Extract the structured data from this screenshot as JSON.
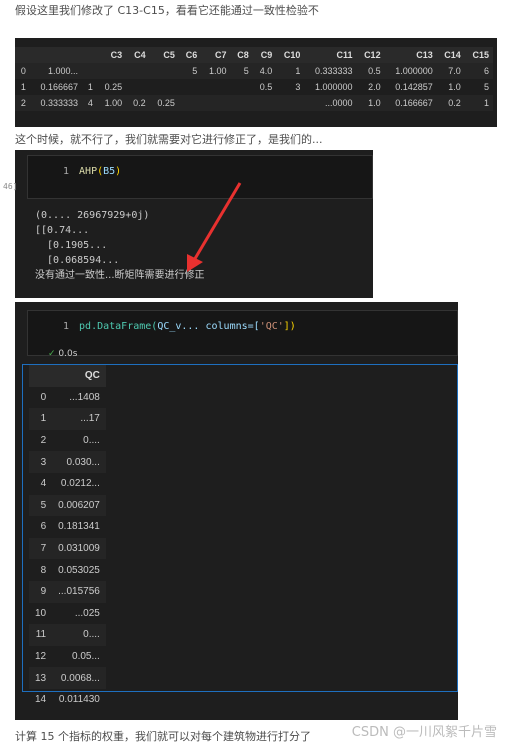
{
  "text1": "假设这里我们修改了 C13-C15，看看它还能通过一致性检验不",
  "table1": {
    "headers": [
      "",
      "",
      "",
      "C3",
      "C4",
      "C5",
      "C6",
      "C7",
      "C8",
      "C9",
      "C10",
      "C11",
      "C12",
      "C13",
      "C14",
      "C15"
    ],
    "rows": [
      [
        "0",
        "1.000...",
        "",
        "",
        "",
        "",
        "5",
        "1.00",
        "5",
        "4.0",
        "1",
        "0.333333",
        "0.5",
        "1.000000",
        "7.0",
        "6"
      ],
      [
        "1",
        "0.166667",
        "1",
        "0.25",
        "",
        "",
        "",
        "",
        "",
        "0.5",
        "3",
        "1.000000",
        "2.0",
        "0.142857",
        "1.0",
        "5"
      ],
      [
        "2",
        "0.333333",
        "4",
        "1.00",
        "0.2",
        "0.25",
        "",
        "",
        "",
        "",
        "",
        "...0000",
        "1.0",
        "0.166667",
        "0.2",
        "1"
      ]
    ]
  },
  "text2": "这个时候，就不行了，我们就需要对它进行修正了，是我们的...",
  "cell1": {
    "line_no": "1",
    "fn": "AHP",
    "arg": "B5",
    "exec_count": "46]",
    "output": [
      "(0.... 26967929+0j)",
      "[[0.74...",
      "  [0.1905...",
      "  [0.068594...",
      "没有通过一致性...断矩阵需要进行修正"
    ]
  },
  "cell2": {
    "line_no": "1",
    "code_a": "pd.DataFrame(",
    "code_b": "QC_v...",
    "code_c": " columns=[",
    "code_str": "'QC'",
    "code_d": "])",
    "status": "✓",
    "time": "0.0s",
    "header": "QC",
    "rows": [
      [
        "0",
        "...1408"
      ],
      [
        "1",
        "...17"
      ],
      [
        "2",
        "0...."
      ],
      [
        "3",
        "0.030..."
      ],
      [
        "4",
        "0.0212..."
      ],
      [
        "5",
        "0.006207"
      ],
      [
        "6",
        "0.181341"
      ],
      [
        "7",
        "0.031009"
      ],
      [
        "8",
        "0.053025"
      ],
      [
        "9",
        "...015756"
      ],
      [
        "10",
        "...025"
      ],
      [
        "11",
        "0...."
      ],
      [
        "12",
        "0.05..."
      ],
      [
        "13",
        "0.0068..."
      ],
      [
        "14",
        "0.011430"
      ]
    ]
  },
  "text3": "计算 15 个指标的权重，我们就可以对每个建筑物进行打分了",
  "watermark": "CSDN @一川风絮千片雪",
  "colors": {
    "arrow": "#e8312f",
    "frame": "#1e6fbf"
  }
}
